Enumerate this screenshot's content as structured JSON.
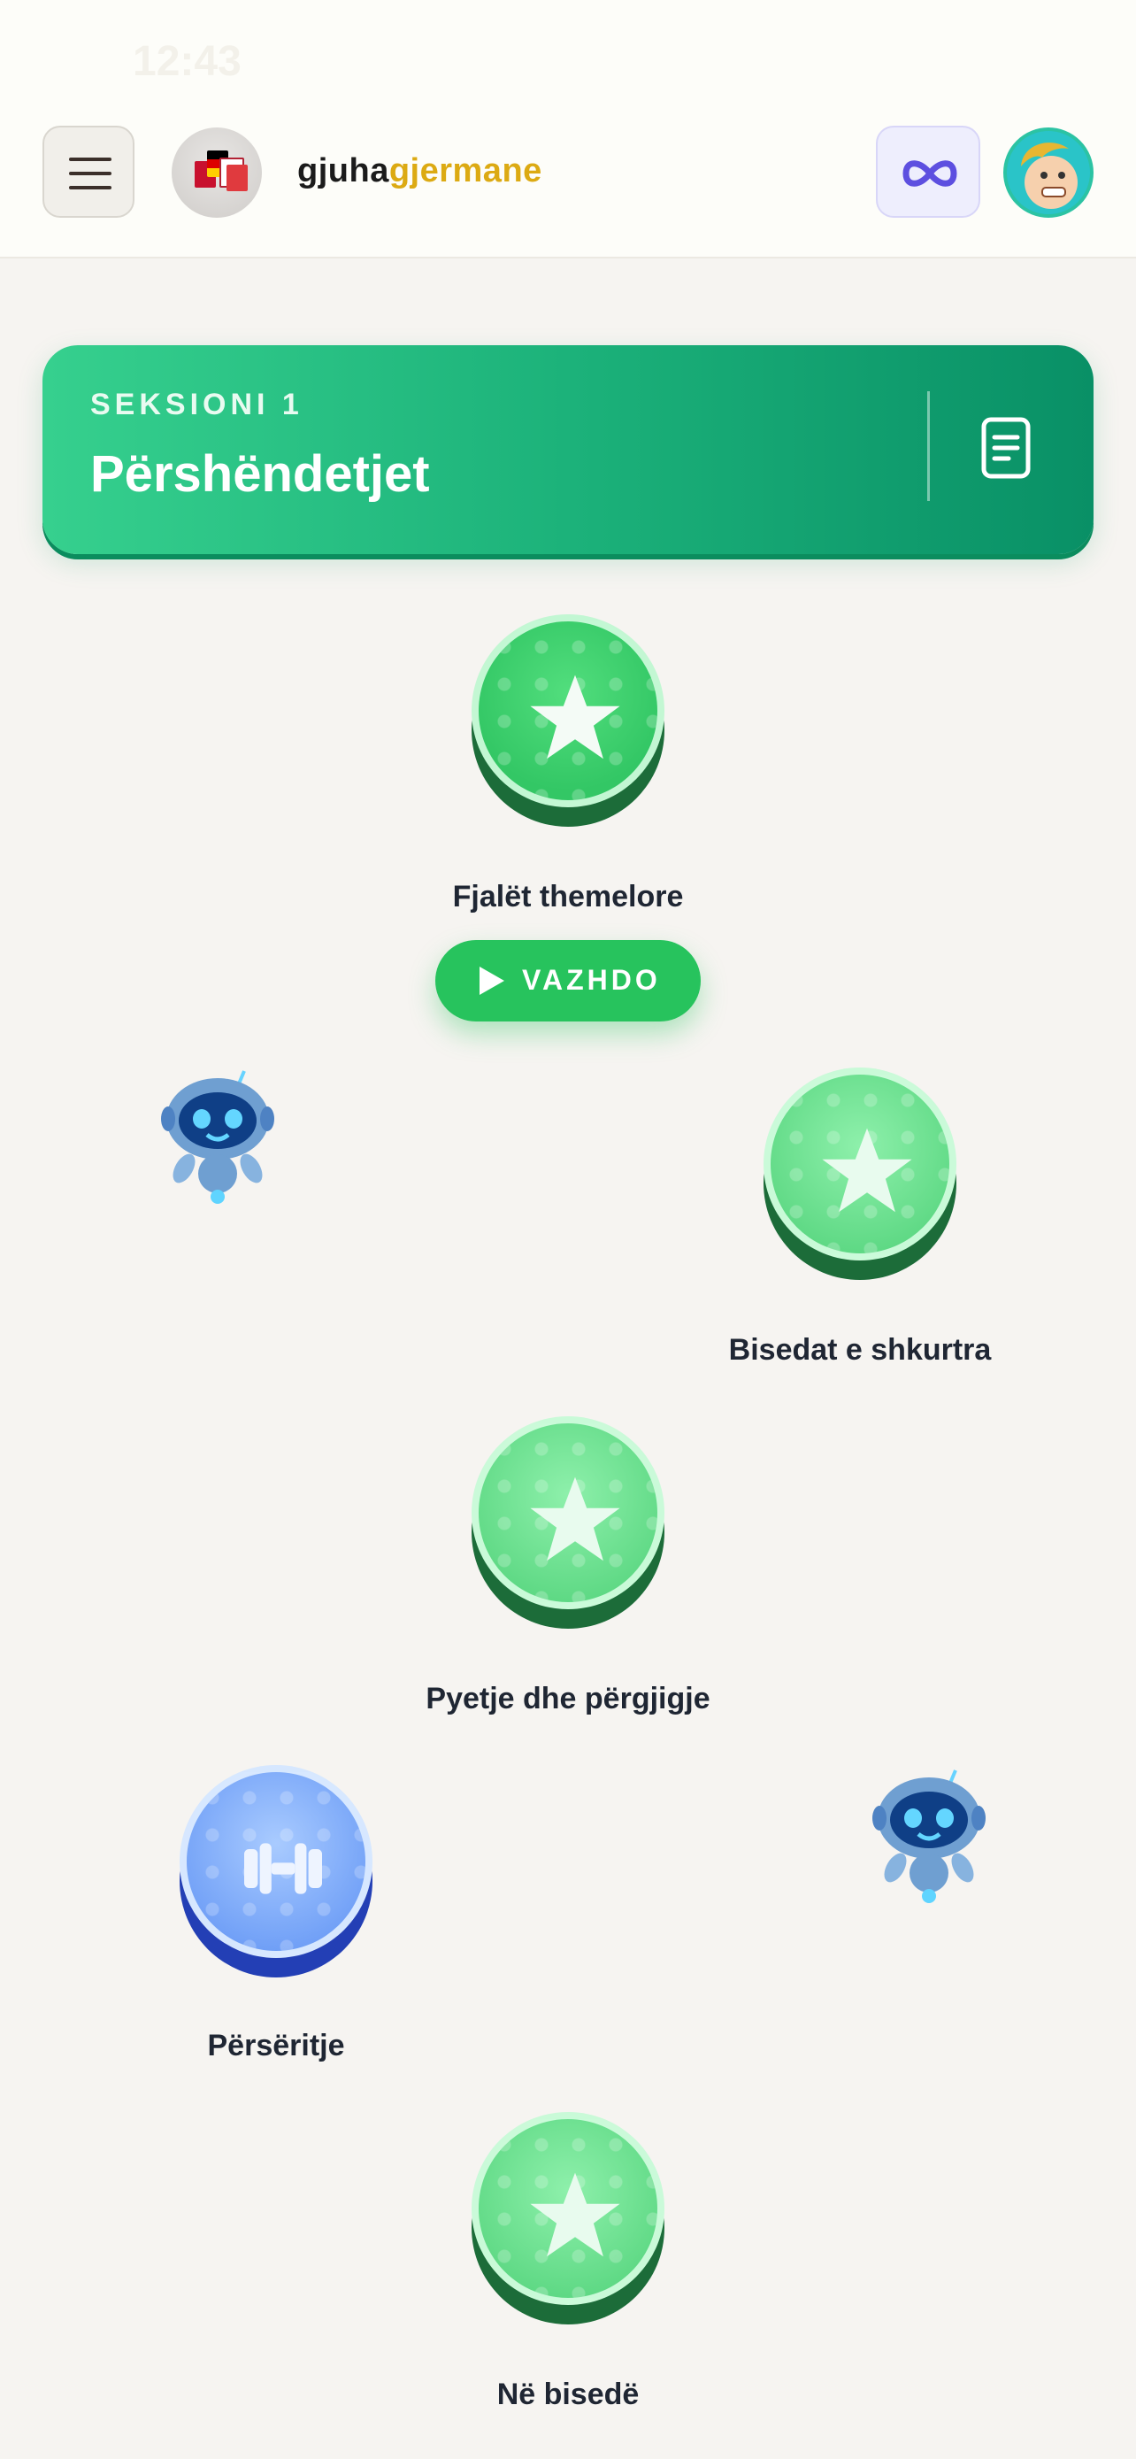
{
  "status_bar": {
    "time": "12:43"
  },
  "header": {
    "brand_prefix": "gjuha",
    "brand_accent": "gjermane",
    "brand_accent_color": "#dcaa13",
    "menu_icon": "hamburger-icon",
    "infinity_icon": "infinity-icon"
  },
  "section": {
    "label": "SEKSIONI 1",
    "title": "Përshëndetjet",
    "guide_icon": "document-icon"
  },
  "path_nodes": [
    {
      "label": "Fjalët themelore",
      "icon": "star-icon",
      "state": "active"
    },
    {
      "label": "Bisedat e shkurtra",
      "icon": "star-icon",
      "state": "locked"
    },
    {
      "label": "Pyetje dhe përgjigje",
      "icon": "star-icon",
      "state": "locked"
    },
    {
      "label": "Përsëritje",
      "icon": "dumbbell-icon",
      "state": "practice"
    },
    {
      "label": "Në bisedë",
      "icon": "star-icon",
      "state": "locked"
    }
  ],
  "continue_button": {
    "label": "VAZHDO"
  },
  "colors": {
    "accent_green": "#27c35d",
    "section_gradient_start": "#36d08e",
    "section_gradient_end": "#099066",
    "practice_blue": "#6d9df6"
  }
}
